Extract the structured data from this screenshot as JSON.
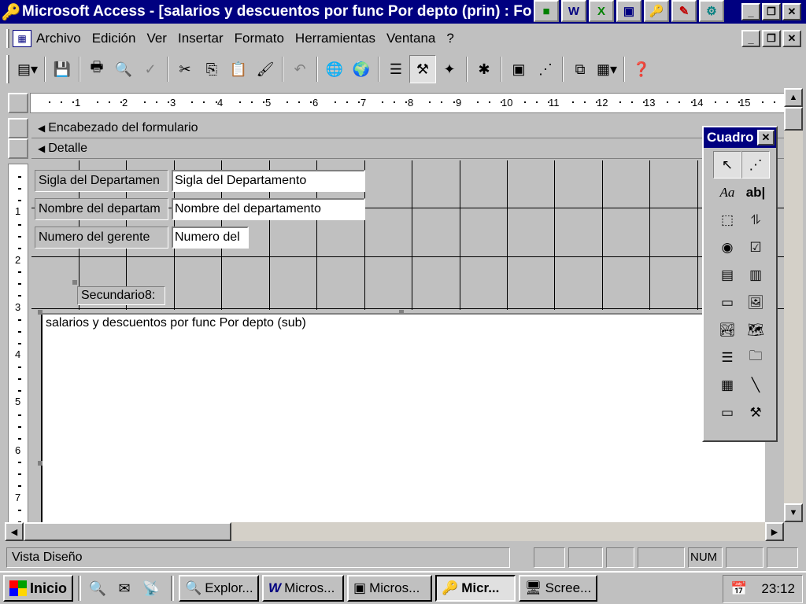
{
  "window": {
    "title": "Microsoft Access - [salarios y descuentos por func Por depto (prin) : Fo",
    "quicklaunch": [
      "W",
      "X",
      "▣",
      "🔑",
      "✎",
      "⚙"
    ]
  },
  "menu": {
    "items": [
      "Archivo",
      "Edición",
      "Ver",
      "Insertar",
      "Formato",
      "Herramientas",
      "Ventana",
      "?"
    ]
  },
  "toolbar": {
    "icons": [
      "form-view-icon",
      "save-icon",
      "print-icon",
      "print-preview-icon",
      "spelling-icon",
      "cut-icon",
      "copy-icon",
      "paste-icon",
      "format-painter-icon",
      "undo-icon",
      "insert-hyperlink-icon",
      "web-toolbar-icon",
      "field-list-icon",
      "toolbox-icon",
      "autoformat-icon",
      "code-icon",
      "properties-icon",
      "build-icon",
      "database-window-icon",
      "new-object-icon",
      "help-icon"
    ]
  },
  "ruler": {
    "top_numbers": [
      "1",
      "2",
      "3",
      "4",
      "5",
      "6",
      "7",
      "8",
      "9",
      "10",
      "11",
      "12",
      "13",
      "14",
      "15"
    ],
    "left_numbers": [
      "1",
      "2",
      "3",
      "4",
      "5",
      "6",
      "7"
    ]
  },
  "form": {
    "header_section": "Encabezado del formulario",
    "detail_section": "Detalle",
    "fields": [
      {
        "label": "Sigla del Departamen",
        "value": "Sigla del Departamento"
      },
      {
        "label": "Nombre del departam",
        "value": "Nombre del departamento"
      },
      {
        "label": "Numero del gerente",
        "value": "Numero del"
      }
    ],
    "subform_label": "Secundario8:",
    "subform_caption": "salarios y descuentos por func Por depto (sub)"
  },
  "toolbox": {
    "title": "Cuadro",
    "tools": [
      "select-objects-icon",
      "control-wizards-icon",
      "label-icon",
      "textbox-icon",
      "option-group-icon",
      "toggle-button-icon",
      "option-button-icon",
      "checkbox-icon",
      "combobox-icon",
      "listbox-icon",
      "command-button-icon",
      "image-icon",
      "unbound-object-frame-icon",
      "bound-object-frame-icon",
      "page-break-icon",
      "tab-control-icon",
      "subform-icon",
      "line-icon",
      "rectangle-icon",
      "more-controls-icon"
    ]
  },
  "status": {
    "text": "Vista Diseño",
    "num": "NUM"
  },
  "taskbar": {
    "start": "Inicio",
    "buttons": [
      "Explor...",
      "Micros...",
      "Micros...",
      "Micr...",
      "Scree..."
    ],
    "clock": "23:12"
  }
}
